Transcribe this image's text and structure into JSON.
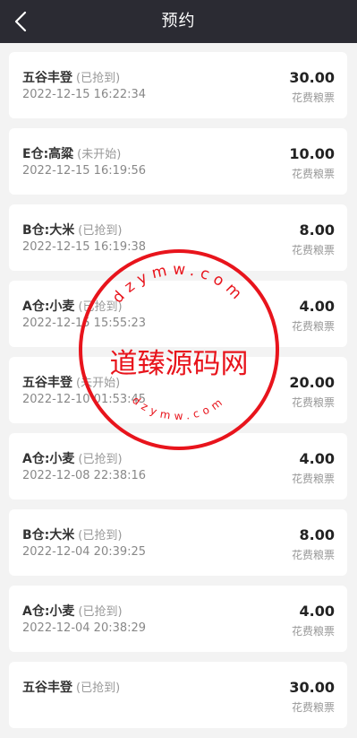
{
  "header": {
    "title": "预约",
    "back_icon": "chevron-left-icon"
  },
  "unit_label": "花费粮票",
  "records": [
    {
      "name": "五谷丰登",
      "status": "(已抢到)",
      "time": "2022-12-15 16:22:34",
      "amount": "30.00"
    },
    {
      "name": "E仓:高粱",
      "status": "(未开始)",
      "time": "2022-12-15 16:19:56",
      "amount": "10.00"
    },
    {
      "name": "B仓:大米",
      "status": "(已抢到)",
      "time": "2022-12-15 16:19:38",
      "amount": "8.00"
    },
    {
      "name": "A仓:小麦",
      "status": "(已抢到)",
      "time": "2022-12-15 15:55:23",
      "amount": "4.00"
    },
    {
      "name": "五谷丰登",
      "status": "(未开始)",
      "time": "2022-12-10 01:53:45",
      "amount": "20.00"
    },
    {
      "name": "A仓:小麦",
      "status": "(已抢到)",
      "time": "2022-12-08 22:38:16",
      "amount": "4.00"
    },
    {
      "name": "B仓:大米",
      "status": "(已抢到)",
      "time": "2022-12-04 20:39:25",
      "amount": "8.00"
    },
    {
      "name": "A仓:小麦",
      "status": "(已抢到)",
      "time": "2022-12-04 20:38:29",
      "amount": "4.00"
    },
    {
      "name": "五谷丰登",
      "status": "(已抢到)",
      "time": "",
      "amount": "30.00"
    }
  ],
  "watermark": {
    "main_text": "道臻源码网",
    "ring_text": "dzymw.com",
    "color": "#e8141c"
  }
}
